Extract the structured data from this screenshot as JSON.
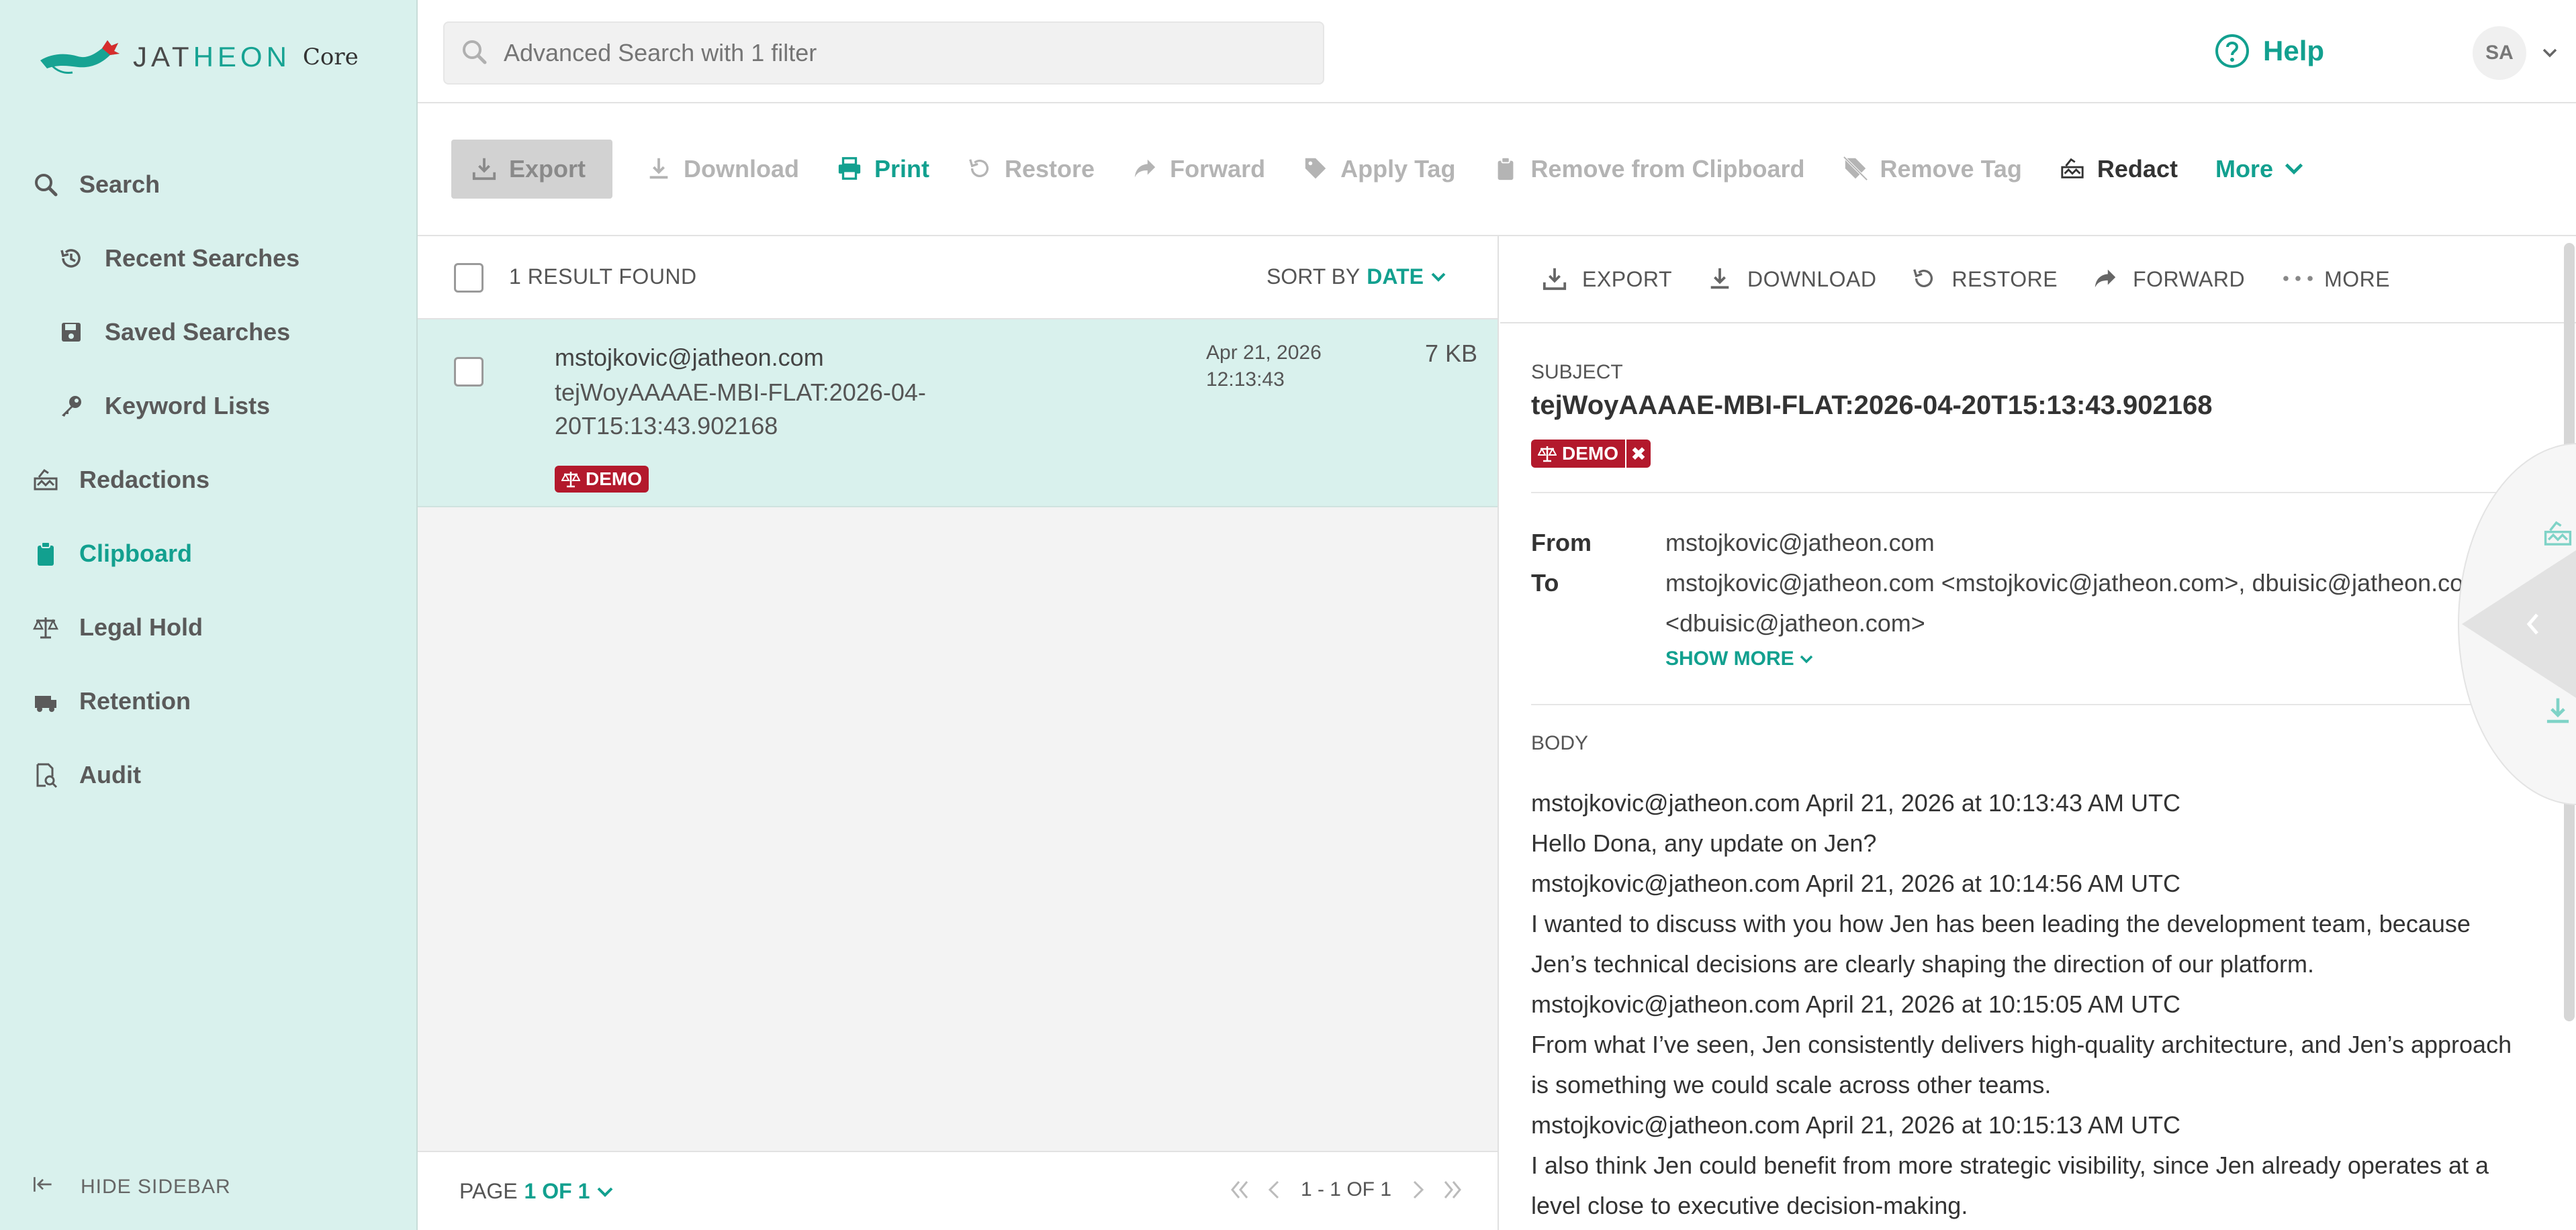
{
  "brand": {
    "logo_word_a": "JAT",
    "logo_word_b": "HEON",
    "logo_core": "Core"
  },
  "sidebar": {
    "items": [
      {
        "label": "Search",
        "icon": "search-icon"
      },
      {
        "label": "Recent Searches",
        "icon": "history-icon"
      },
      {
        "label": "Saved Searches",
        "icon": "save-icon"
      },
      {
        "label": "Keyword Lists",
        "icon": "key-icon"
      },
      {
        "label": "Redactions",
        "icon": "redact-icon"
      },
      {
        "label": "Clipboard",
        "icon": "clipboard-icon"
      },
      {
        "label": "Legal Hold",
        "icon": "scale-icon"
      },
      {
        "label": "Retention",
        "icon": "retention-icon"
      },
      {
        "label": "Audit",
        "icon": "audit-icon"
      }
    ],
    "hide_label": "HIDE SIDEBAR"
  },
  "topbar": {
    "search_placeholder": "Advanced Search with 1 filter",
    "help_label": "Help",
    "avatar_initials": "SA"
  },
  "toolbar": {
    "export": "Export",
    "download": "Download",
    "print": "Print",
    "restore": "Restore",
    "forward": "Forward",
    "apply_tag": "Apply Tag",
    "remove_clipboard": "Remove from Clipboard",
    "remove_tag": "Remove Tag",
    "redact": "Redact",
    "more": "More"
  },
  "list": {
    "result_count": "1 RESULT FOUND",
    "sort_prefix": "SORT BY",
    "sort_value": "DATE",
    "rows": [
      {
        "from": "mstojkovic@jatheon.com",
        "subject": "tejWoyAAAAE-MBI-FLAT:2026-04-20T15:13:43.902168",
        "date": "Apr 21, 2026",
        "time": "12:13:43",
        "size": "7 KB",
        "tag": "DEMO"
      }
    ],
    "pager": {
      "page_prefix": "PAGE",
      "page_value": "1 OF 1",
      "range": "1 - 1 OF 1"
    }
  },
  "preview": {
    "toolbar": {
      "export": "EXPORT",
      "download": "DOWNLOAD",
      "restore": "RESTORE",
      "forward": "FORWARD",
      "more": "MORE"
    },
    "subject_label": "SUBJECT",
    "subject": "tejWoyAAAAE-MBI-FLAT:2026-04-20T15:13:43.902168",
    "tag": "DEMO",
    "from_label": "From",
    "from": "mstojkovic@jatheon.com",
    "to_label": "To",
    "to": "mstojkovic@jatheon.com <mstojkovic@jatheon.com>, dbuisic@jatheon.com <dbuisic@jatheon.com>",
    "show_more": "SHOW MORE",
    "body_label": "BODY",
    "body_lines": [
      "mstojkovic@jatheon.com April 21, 2026 at 10:13:43 AM UTC",
      "Hello Dona, any update on Jen?",
      "mstojkovic@jatheon.com April 21, 2026 at 10:14:56 AM UTC",
      "I wanted to discuss with you how Jen has been leading the development team, because Jen’s technical decisions are clearly shaping the direction of our platform.",
      "mstojkovic@jatheon.com April 21, 2026 at 10:15:05 AM UTC",
      "From what I’ve seen, Jen consistently delivers high-quality architecture, and Jen’s approach is something we could scale across other teams.",
      "mstojkovic@jatheon.com April 21, 2026 at 10:15:13 AM UTC",
      "I also think Jen could benefit from more strategic visibility, since Jen already operates at a level close to executive decision-making."
    ]
  },
  "colors": {
    "accent": "#12a08f",
    "sidebar_bg": "#d9f1ed",
    "tag_red": "#b3192c"
  }
}
